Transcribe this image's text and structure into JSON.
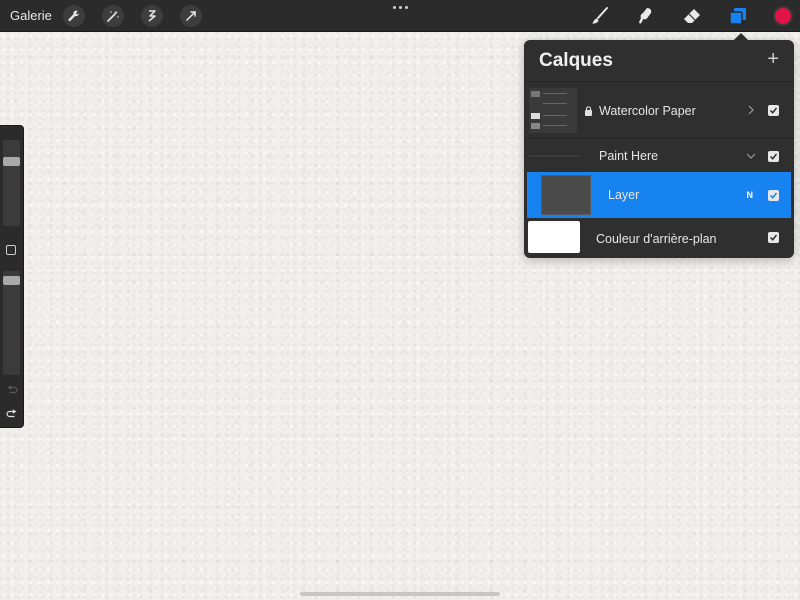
{
  "topbar": {
    "gallery_label": "Galerie",
    "left_tools": [
      "wrench-icon",
      "magic-wand-icon",
      "selection-icon",
      "transform-arrow-icon"
    ],
    "right_tools": [
      "brush-icon",
      "smudge-icon",
      "eraser-icon",
      "layers-icon"
    ],
    "active_tool": "layers-icon",
    "current_color": "#e3134a",
    "accent_color": "#1683f0"
  },
  "layers_panel": {
    "title": "Calques",
    "add_symbol": "+",
    "layers": [
      {
        "name": "Watercolor Paper",
        "type": "group",
        "locked": true,
        "visible": true,
        "expanded": false
      },
      {
        "name": "Paint Here",
        "type": "group",
        "visible": true,
        "expanded": true
      },
      {
        "name": "Layer",
        "type": "layer",
        "selected": true,
        "blend_mode": "N",
        "visible": true
      },
      {
        "name": "Couleur d'arrière-plan",
        "type": "background",
        "visible": true,
        "color": "#ffffff"
      }
    ]
  },
  "sidebar": {
    "brush_size": 0.95,
    "opacity": 0.96
  }
}
